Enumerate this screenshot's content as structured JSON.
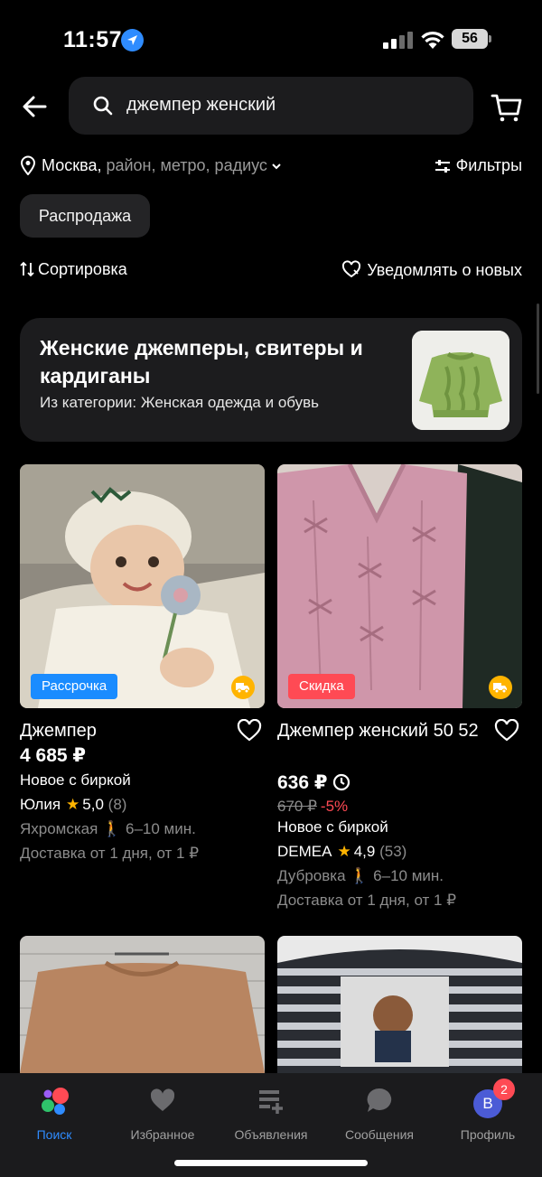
{
  "status_bar": {
    "time": "11:57",
    "battery": "56"
  },
  "search": {
    "query": "джемпер женский"
  },
  "location": {
    "city": "Москва,",
    "rest": " район, метро, радиус"
  },
  "filters_label": "Фильтры",
  "chip_label": "Распродажа",
  "sort_label": "Сортировка",
  "notify_label": "Уведомлять о новых",
  "category": {
    "title": "Женские джемперы, свитеры и кардиганы",
    "subtitle": "Из категории: Женская одежда и обувь"
  },
  "products": [
    {
      "badge": "Рассрочка",
      "name": "Джемпер",
      "price": "4 685 ₽",
      "condition": "Новое с биркой",
      "seller": "Юлия",
      "rating": "5,0",
      "reviews": "(8)",
      "metro": "Яхромская",
      "walk": "6–10 мин.",
      "delivery": "Доставка от 1 дня, от 1 ₽"
    },
    {
      "badge": "Скидка",
      "name": "Джемпер женский 50 52",
      "price": "636 ₽",
      "old_price": "670 ₽",
      "discount": "-5%",
      "condition": "Новое с биркой",
      "seller": "DEMEA",
      "rating": "4,9",
      "reviews": "(53)",
      "metro": "Дубровка",
      "walk": "6–10 мин.",
      "delivery": "Доставка от 1 дня, от 1 ₽"
    }
  ],
  "tabs": [
    {
      "label": "Поиск",
      "icon": "search-logo-icon"
    },
    {
      "label": "Избранное",
      "icon": "heart-icon"
    },
    {
      "label": "Объявления",
      "icon": "list-add-icon"
    },
    {
      "label": "Сообщения",
      "icon": "chat-icon"
    },
    {
      "label": "Профиль",
      "icon": "avatar",
      "avatar_letter": "B",
      "badge": "2"
    }
  ],
  "colors": {
    "accent": "#2f8cff",
    "sale": "#ff4a54",
    "star": "#ffb400",
    "card": "#1c1c1e"
  }
}
